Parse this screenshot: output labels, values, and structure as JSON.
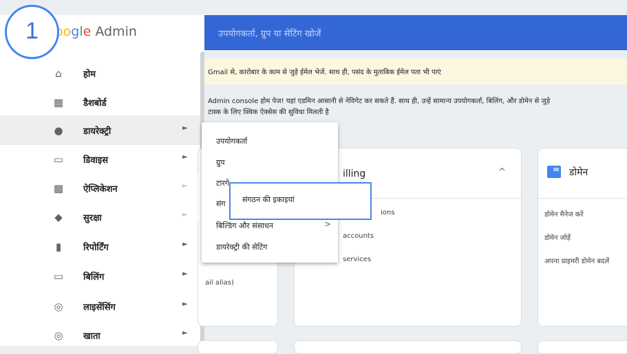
{
  "header": {
    "logo_prefix": "oo",
    "logo_g": "g",
    "logo_l": "l",
    "logo_e": "e",
    "logo_product": " Admin",
    "search_placeholder": "उपयोगकर्ता, ग्रुप या सेटिंग खोजें"
  },
  "step": {
    "number": "1"
  },
  "sidebar": {
    "items": [
      {
        "label": "होम",
        "icon": "home-icon",
        "glyph": "⌂",
        "has_chevron": false
      },
      {
        "label": "डैशबोर्ड",
        "icon": "dashboard-icon",
        "glyph": "▦",
        "has_chevron": false
      },
      {
        "label": "डायरेक्ट्री",
        "icon": "person-icon",
        "glyph": "●",
        "has_chevron": true,
        "active": true
      },
      {
        "label": "डिवाइस",
        "icon": "devices-icon",
        "glyph": "▭",
        "has_chevron": true
      },
      {
        "label": "ऐप्लिकेशन",
        "icon": "apps-icon",
        "glyph": "▩",
        "has_chevron": true
      },
      {
        "label": "सुरक्षा",
        "icon": "shield-icon",
        "glyph": "◆",
        "has_chevron": true
      },
      {
        "label": "रिपोर्टिंग",
        "icon": "bar-chart-icon",
        "glyph": "▮",
        "has_chevron": true
      },
      {
        "label": "बिलिंग",
        "icon": "credit-card-icon",
        "glyph": "▭",
        "has_chevron": true
      },
      {
        "label": "लाइसेंसिंग",
        "icon": "license-icon",
        "glyph": "◎",
        "has_chevron": true
      },
      {
        "label": "खाता",
        "icon": "account-icon",
        "glyph": "◎",
        "has_chevron": true
      }
    ],
    "chevron": "►"
  },
  "content": {
    "banner": "Gmail से, कारोबार के काम से जुड़े ईमेल भेजें. साथ ही, पसंद के मुताबिक ईमेल पता भी पाएं",
    "welcome_line1": "Admin console होम पेज! यहां एडमिन आसानी से नेविगेट कर सकते हैं. साथ ही, उन्हें सामान्य उपयोगकर्ता, बिलिंग, और डोमेन से जुड़े",
    "welcome_line2": "टास्क के लिए क्विक ऐक्सेस की सुविधा मिलती है",
    "left_card_fragment": "ail alias)",
    "billing_card": {
      "title_fragment": "illing",
      "collapse_icon": "^",
      "link1_fragment": "ions",
      "link2_fragment": "accounts",
      "link3_fragment": "services"
    },
    "domain_card": {
      "title": "डोमेन",
      "links": [
        "डोमेन मैनेज करें",
        "डोमेन जोड़ें",
        "अपना प्राइमरी डोमेन बदलें"
      ]
    }
  },
  "dropdown": {
    "items": [
      "उपयोगकर्ता",
      "ग्रुप",
      "टारगेट ऑडियंस",
      "संगठन की इकाइयां",
      "बिल्डिंग और संसाधन",
      "डायरेक्ट्री की सेटिंग"
    ],
    "visible_fragment_3": "टारगे",
    "visible_fragment_4": "संग",
    "submenu_arrow": ">"
  },
  "submenu": {
    "label": "संगठन की इकाइयां"
  }
}
